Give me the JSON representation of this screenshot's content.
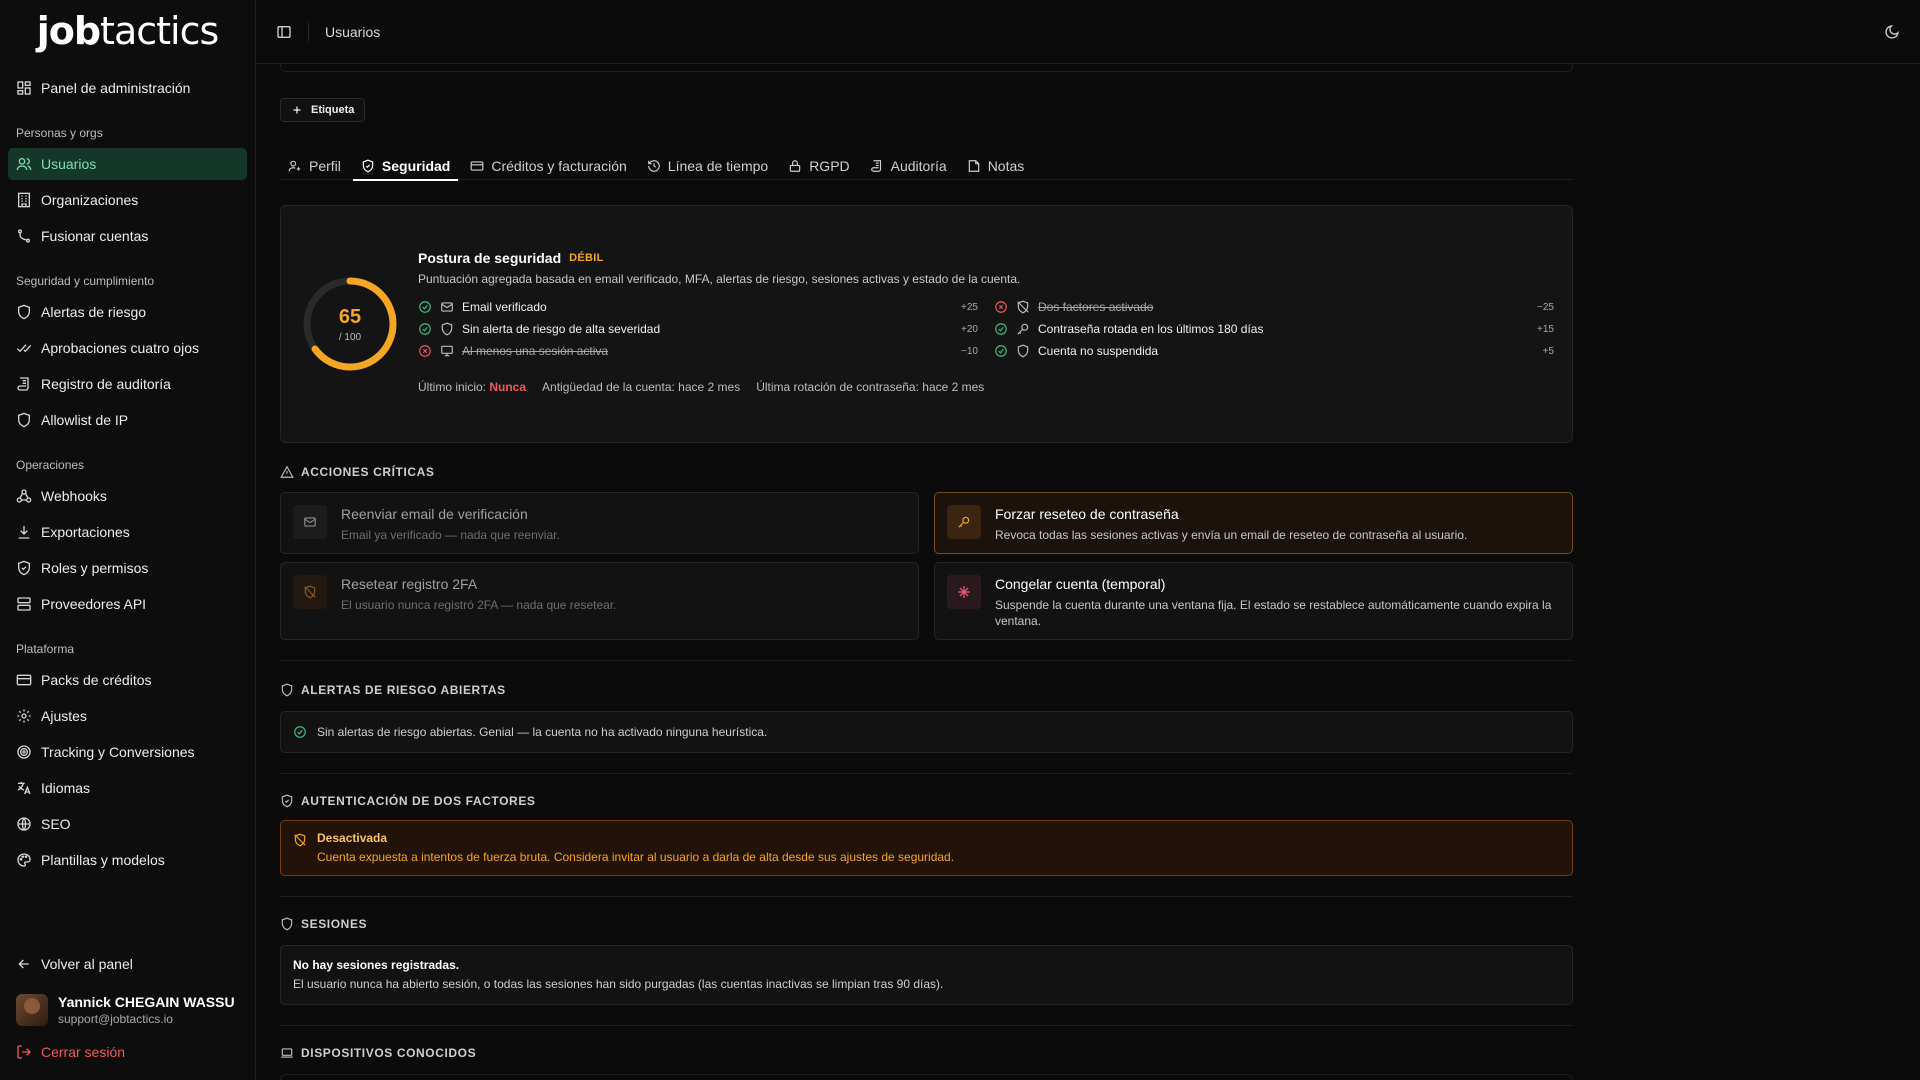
{
  "brand": {
    "logo_bold": "job",
    "logo_regular": "tactics"
  },
  "sidebar": {
    "top_item": {
      "label": "Panel de administración",
      "icon": "dashboard-icon"
    },
    "groups": [
      {
        "title": "Personas y orgs",
        "items": [
          {
            "label": "Usuarios",
            "icon": "users-icon",
            "active": true
          },
          {
            "label": "Organizaciones",
            "icon": "building-icon"
          },
          {
            "label": "Fusionar cuentas",
            "icon": "merge-icon"
          }
        ]
      },
      {
        "title": "Seguridad y cumplimiento",
        "items": [
          {
            "label": "Alertas de riesgo",
            "icon": "shield-icon"
          },
          {
            "label": "Aprobaciones cuatro ojos",
            "icon": "double-check-icon"
          },
          {
            "label": "Registro de auditoría",
            "icon": "scroll-icon"
          },
          {
            "label": "Allowlist de IP",
            "icon": "shield-icon"
          }
        ]
      },
      {
        "title": "Operaciones",
        "items": [
          {
            "label": "Webhooks",
            "icon": "webhook-icon"
          },
          {
            "label": "Exportaciones",
            "icon": "download-icon"
          },
          {
            "label": "Roles y permisos",
            "icon": "shield-check-icon"
          },
          {
            "label": "Proveedores API",
            "icon": "server-icon"
          }
        ]
      },
      {
        "title": "Plataforma",
        "items": [
          {
            "label": "Packs de créditos",
            "icon": "credit-card-icon"
          },
          {
            "label": "Ajustes",
            "icon": "gear-icon"
          },
          {
            "label": "Tracking y Conversiones",
            "icon": "target-icon"
          },
          {
            "label": "Idiomas",
            "icon": "languages-icon"
          },
          {
            "label": "SEO",
            "icon": "globe-icon"
          },
          {
            "label": "Plantillas y modelos",
            "icon": "palette-icon"
          }
        ]
      }
    ],
    "back_label": "Volver al panel",
    "user": {
      "name": "Yannick CHEGAIN WASSU",
      "email": "support@jobtactics.io"
    },
    "logout_label": "Cerrar sesión"
  },
  "topbar": {
    "breadcrumb": "Usuarios"
  },
  "tag_button_label": "Etiqueta",
  "tabs": [
    {
      "label": "Perfil",
      "icon": "user-key-icon"
    },
    {
      "label": "Seguridad",
      "icon": "shield-check-icon",
      "active": true
    },
    {
      "label": "Créditos y facturación",
      "icon": "credit-card-icon"
    },
    {
      "label": "Línea de tiempo",
      "icon": "history-icon"
    },
    {
      "label": "RGPD",
      "icon": "lock-icon"
    },
    {
      "label": "Auditoría",
      "icon": "scroll-icon"
    },
    {
      "label": "Notas",
      "icon": "sticky-note-icon"
    }
  ],
  "posture": {
    "score": "65",
    "score_max": "/ 100",
    "score_value": 65,
    "title": "Postura de seguridad",
    "level": "DÉBIL",
    "subtitle": "Puntuación agregada basada en email verificado, MFA, alertas de riesgo, sesiones activas y estado de la cuenta.",
    "checks_left": [
      {
        "label": "Email verificado",
        "points": "+25",
        "ok": true,
        "icon": "mail-icon"
      },
      {
        "label": "Sin alerta de riesgo de alta severidad",
        "points": "+20",
        "ok": true,
        "icon": "shield-icon"
      },
      {
        "label": "Al menos una sesión activa",
        "points": "−10",
        "ok": false,
        "icon": "monitor-icon"
      }
    ],
    "checks_right": [
      {
        "label": "Dos factores activado",
        "points": "−25",
        "ok": false,
        "icon": "shield-off-icon"
      },
      {
        "label": "Contraseña rotada en los últimos 180 días",
        "points": "+15",
        "ok": true,
        "icon": "key-icon"
      },
      {
        "label": "Cuenta no suspendida",
        "points": "+5",
        "ok": true,
        "icon": "shield-icon"
      }
    ],
    "meta": {
      "last_login_label": "Último inicio:",
      "last_login_value": "Nunca",
      "age": "Antigüedad de la cuenta: hace 2 mes",
      "rotation": "Última rotación de contraseña: hace 2 mes"
    }
  },
  "critical": {
    "title": "Acciones críticas",
    "actions": [
      {
        "title": "Reenviar email de verificación",
        "desc": "Email ya verificado — nada que reenviar.",
        "icon": "mail-icon"
      },
      {
        "title": "Forzar reseteo de contraseña",
        "desc": "Revoca todas las sesiones activas y envía un email de reseteo de contraseña al usuario.",
        "icon": "key-icon"
      },
      {
        "title": "Resetear registro 2FA",
        "desc": "El usuario nunca registró 2FA — nada que resetear.",
        "icon": "shield-off-icon"
      },
      {
        "title": "Congelar cuenta (temporal)",
        "desc": "Suspende la cuenta durante una ventana fija. El estado se restablece automáticamente cuando expira la ventana.",
        "icon": "snowflake-icon"
      }
    ]
  },
  "risk_alerts": {
    "title": "Alertas de riesgo abiertas",
    "message": "Sin alertas de riesgo abiertas. Genial — la cuenta no ha activado ninguna heurística."
  },
  "twofa": {
    "title": "Autenticación de dos factores",
    "status": "Desactivada",
    "message": "Cuenta expuesta a intentos de fuerza bruta. Considera invitar al usuario a darla de alta desde sus ajustes de seguridad."
  },
  "sessions": {
    "title": "Sesiones",
    "empty_title": "No hay sesiones registradas.",
    "empty_desc": "El usuario nunca ha abierto sesión, o todas las sesiones han sido purgadas (las cuentas inactivas se limpian tras 90 días)."
  },
  "devices": {
    "title": "Dispositivos conocidos"
  },
  "colors": {
    "accent_green": "#7fe0ae",
    "active_bg": "#14372a",
    "warning": "#f5a623",
    "danger": "#ef5a5a"
  }
}
